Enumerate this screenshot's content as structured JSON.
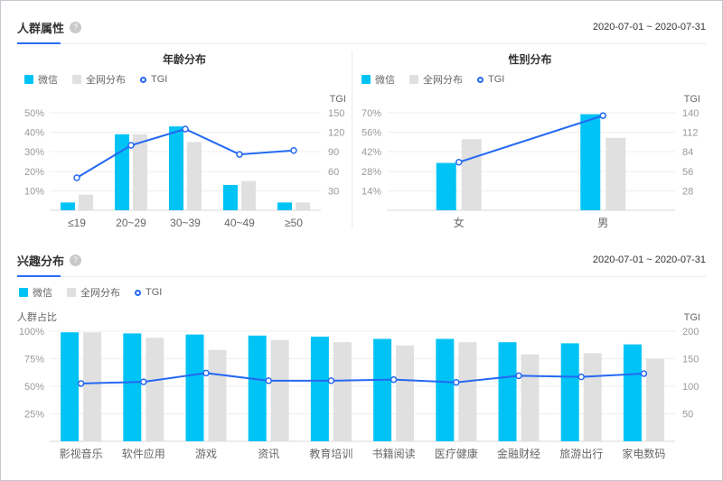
{
  "colors": {
    "wechat_bar": "#00c3f5",
    "network_bar": "#e0e0e0",
    "tgi_line": "#2468f2",
    "accent_underline": "#2a6cf5",
    "grid_line": "#efefef",
    "baseline": "#d9d9d9",
    "axis_text": "#999999",
    "category_text": "#666666",
    "help_icon_bg": "#c9c9c9"
  },
  "sections": [
    {
      "title": "人群属性",
      "help_icon": "?",
      "date_range": "2020-07-01 ~ 2020-07-31"
    },
    {
      "title": "兴趣分布",
      "help_icon": "?",
      "date_range": "2020-07-01 ~ 2020-07-31"
    }
  ],
  "chart_data": [
    {
      "type": "bar+line",
      "title": "年龄分布",
      "legend_position": "top-left",
      "grid": true,
      "categories": [
        "≤19",
        "20~29",
        "30~39",
        "40~49",
        "≥50"
      ],
      "series": [
        {
          "name": "微信",
          "type": "bar",
          "axis": "left",
          "values": [
            4,
            39,
            43,
            13,
            4
          ]
        },
        {
          "name": "全网分布",
          "type": "bar",
          "axis": "left",
          "values": [
            8,
            39,
            35,
            15,
            4
          ]
        },
        {
          "name": "TGI",
          "type": "line",
          "axis": "right",
          "values": [
            50,
            100,
            125,
            86,
            92
          ]
        }
      ],
      "left_axis": {
        "title": "",
        "unit": "%",
        "max": 50,
        "ticks": [
          10,
          20,
          30,
          40,
          50
        ]
      },
      "right_axis": {
        "title": "TGI",
        "unit": "",
        "max": 150,
        "ticks": [
          30,
          60,
          90,
          120,
          150
        ]
      }
    },
    {
      "type": "bar+line",
      "title": "性别分布",
      "legend_position": "top-left",
      "grid": true,
      "categories": [
        "女",
        "男"
      ],
      "series": [
        {
          "name": "微信",
          "type": "bar",
          "axis": "left",
          "values": [
            34,
            69
          ]
        },
        {
          "name": "全网分布",
          "type": "bar",
          "axis": "left",
          "values": [
            51,
            52
          ]
        },
        {
          "name": "TGI",
          "type": "line",
          "axis": "right",
          "values": [
            69,
            136
          ]
        }
      ],
      "left_axis": {
        "title": "",
        "unit": "%",
        "max": 70,
        "ticks": [
          14,
          28,
          42,
          56,
          70
        ]
      },
      "right_axis": {
        "title": "TGI",
        "unit": "",
        "max": 140,
        "ticks": [
          28,
          56,
          84,
          112,
          140
        ]
      }
    },
    {
      "type": "bar+line",
      "title": "兴趣分布",
      "legend_position": "top-left",
      "grid": true,
      "categories": [
        "影视音乐",
        "软件应用",
        "游戏",
        "资讯",
        "教育培训",
        "书籍阅读",
        "医疗健康",
        "金融财经",
        "旅游出行",
        "家电数码"
      ],
      "series": [
        {
          "name": "微信",
          "type": "bar",
          "axis": "left",
          "values": [
            99,
            98,
            97,
            96,
            95,
            93,
            93,
            90,
            89,
            88
          ]
        },
        {
          "name": "全网分布",
          "type": "bar",
          "axis": "left",
          "values": [
            99,
            94,
            83,
            92,
            90,
            87,
            90,
            79,
            80,
            75
          ]
        },
        {
          "name": "TGI",
          "type": "line",
          "axis": "right",
          "values": [
            105,
            108,
            124,
            110,
            110,
            112,
            107,
            119,
            117,
            123
          ]
        }
      ],
      "left_axis": {
        "title": "人群占比",
        "unit": "%",
        "max": 100,
        "ticks": [
          25,
          50,
          75,
          100
        ]
      },
      "right_axis": {
        "title": "TGI",
        "unit": "",
        "max": 200,
        "ticks": [
          50,
          100,
          150,
          200
        ]
      }
    }
  ]
}
